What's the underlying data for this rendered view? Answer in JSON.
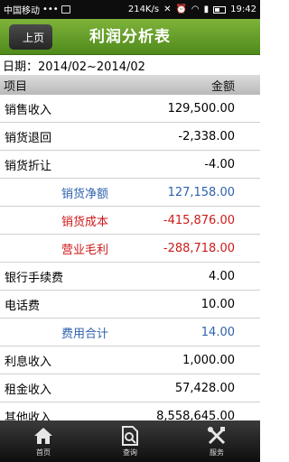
{
  "status_bar": {
    "carrier": "中国移动",
    "dots": "•••",
    "speed": "214K/s",
    "time": "19:42"
  },
  "header": {
    "back_label": "上页",
    "title": "利润分析表"
  },
  "date_line": "日期：2014/02~2014/02",
  "table": {
    "header_item": "项目",
    "header_amount": "金额",
    "rows": [
      {
        "label": "销售收入",
        "value": "129,500.00"
      },
      {
        "label": "销货退回",
        "value": "-2,338.00"
      },
      {
        "label": "销货折让",
        "value": "-4.00"
      },
      {
        "label": "销货净额",
        "value": "127,158.00"
      },
      {
        "label": "销货成本",
        "value": "-415,876.00"
      },
      {
        "label": "营业毛利",
        "value": "-288,718.00"
      },
      {
        "label": "银行手续费",
        "value": "4.00"
      },
      {
        "label": "电话费",
        "value": "10.00"
      },
      {
        "label": "费用合计",
        "value": "14.00"
      },
      {
        "label": "利息收入",
        "value": "1,000.00"
      },
      {
        "label": "租金收入",
        "value": "57,428.00"
      },
      {
        "label": "其他收入",
        "value": "8,558,645.00"
      }
    ]
  },
  "bottom_nav": [
    {
      "label": "首页",
      "icon": "home-icon"
    },
    {
      "label": "查询",
      "icon": "search-document-icon"
    },
    {
      "label": "服务",
      "icon": "tools-icon"
    }
  ],
  "colors": {
    "header_green": "#5f9a24",
    "subtotal_blue": "#2f62ad",
    "negative_red": "#cc1a1a"
  }
}
